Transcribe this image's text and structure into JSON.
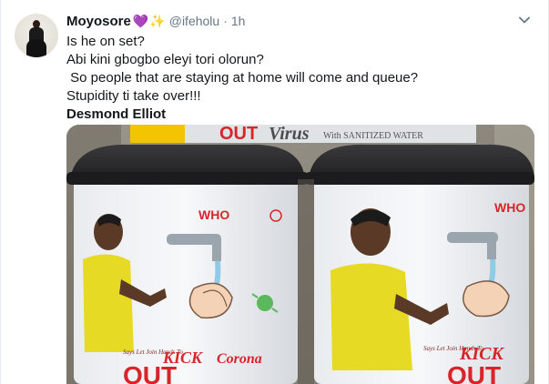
{
  "tweet": {
    "display_name": "Moyosore",
    "emoji_heart": "💜",
    "emoji_sparkles": "✨",
    "handle": "@ifeholu",
    "separator": "·",
    "time": "1h",
    "lines": [
      "Is he on set?",
      "Abi kini gbogbo eleyi tori olorun?",
      " So people that are staying at home will come and queue?",
      "Stupidity ti take over!!!",
      "Desmond Elliot"
    ]
  },
  "media": {
    "banner_text_1": "OUT",
    "banner_text_2": "Virus",
    "banner_text_3": "With SANITIZED WATER",
    "left_bin": {
      "who": "WHO",
      "small_text": "Says Let Join Hands To",
      "kick": "KICK",
      "corona": "Corona",
      "out": "OUT"
    },
    "right_bin": {
      "who": "WHO",
      "small_text": "Says Let Join Hands To",
      "kick": "KICK",
      "out": "OUT"
    }
  },
  "colors": {
    "accent_red": "#d8252a",
    "name_text": "#14171a",
    "muted": "#657786",
    "bin_lid": "#2b2b2d"
  }
}
